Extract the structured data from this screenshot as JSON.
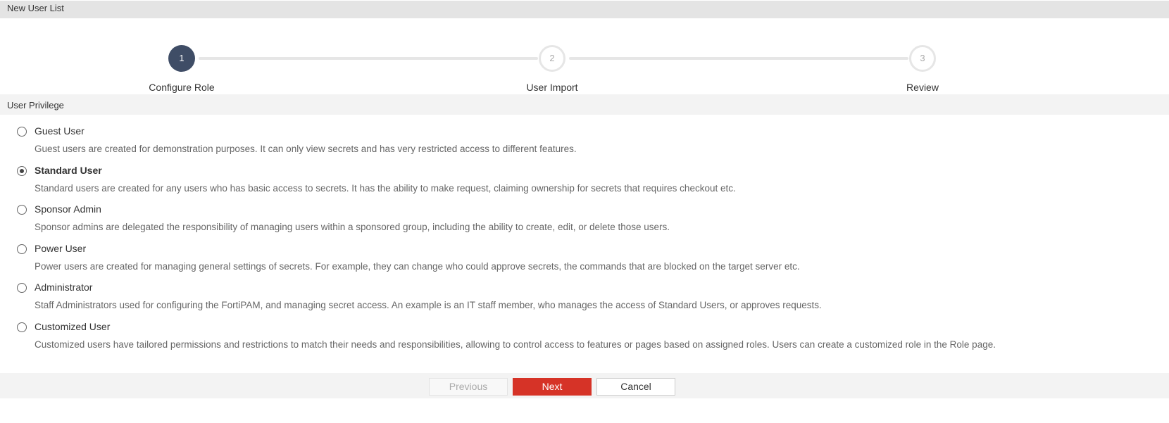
{
  "title": "New User List",
  "steps": [
    {
      "number": "1",
      "label": "Configure Role",
      "state": "active"
    },
    {
      "number": "2",
      "label": "User Import",
      "state": "todo"
    },
    {
      "number": "3",
      "label": "Review",
      "state": "todo"
    }
  ],
  "section": "User Privilege",
  "options": [
    {
      "label": "Guest User",
      "desc": "Guest users are created for demonstration purposes. It can only view secrets and has very restricted access to different features.",
      "selected": false
    },
    {
      "label": "Standard User",
      "desc": "Standard users are created for any users who has basic access to secrets. It has the ability to make request, claiming ownership for secrets that requires checkout etc.",
      "selected": true
    },
    {
      "label": "Sponsor Admin",
      "desc": "Sponsor admins are delegated the responsibility of managing users within a sponsored group, including the ability to create, edit, or delete those users.",
      "selected": false
    },
    {
      "label": "Power User",
      "desc": "Power users are created for managing general settings of secrets. For example, they can change who could approve secrets, the commands that are blocked on the target server etc.",
      "selected": false
    },
    {
      "label": "Administrator",
      "desc": "Staff Administrators used for configuring the FortiPAM, and managing secret access. An example is an IT staff member, who manages the access of Standard Users, or approves requests.",
      "selected": false
    },
    {
      "label": "Customized User",
      "desc": "Customized users have tailored permissions and restrictions to match their needs and responsibilities, allowing to control access to features or pages based on assigned roles. Users can create a customized role in the Role page.",
      "selected": false
    }
  ],
  "buttons": {
    "previous": "Previous",
    "next": "Next",
    "cancel": "Cancel"
  },
  "colors": {
    "accent": "#d63327",
    "step_active": "#3f4d66"
  }
}
